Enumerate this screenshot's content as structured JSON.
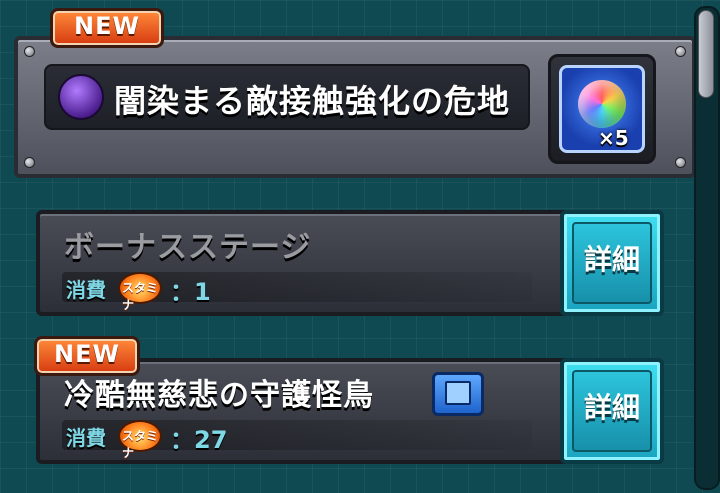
{
  "quest": {
    "new_badge": "NEW",
    "title": "闇染まる敵接触強化の危地",
    "element_icon": "dark-element-icon",
    "reward": {
      "icon": "rainbow-orb-icon",
      "count": "×5"
    }
  },
  "stages": [
    {
      "name": "ボーナスステージ",
      "name_color": "#9a9ca2",
      "new_badge": "",
      "cost_label": "消費",
      "stamina_label": "スタミナ",
      "cost_value": "：1",
      "detail_label": "詳細"
    },
    {
      "name": "冷酷無慈悲の守護怪鳥",
      "name_color": "#ffffff",
      "new_badge": "NEW",
      "cost_label": "消費",
      "stamina_label": "スタミナ",
      "cost_value": "：27",
      "detail_label": "詳細",
      "extra_icon": "book-icon"
    }
  ],
  "colors": {
    "accent": "#2cc4dc",
    "badge": "#e2501c",
    "background": "#0f4a52"
  }
}
